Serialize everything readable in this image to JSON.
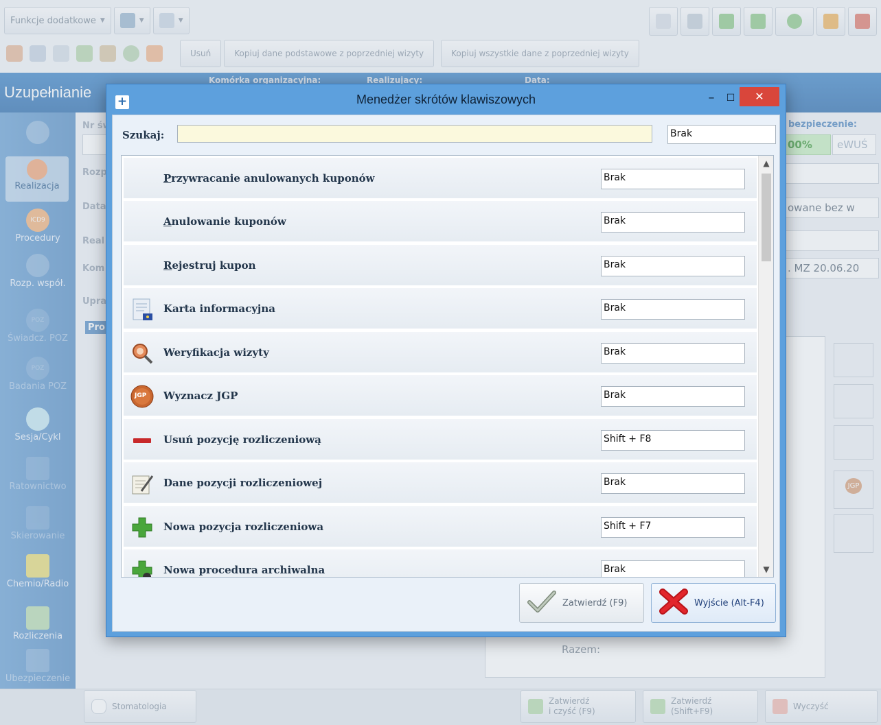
{
  "toolbar": {
    "extra_functions_label": "Funkcje dodatkowe",
    "delete_label": "Usuń",
    "copy_basic_label": "Kopiuj dane podstawowe z poprzedniej wizyty",
    "copy_all_label": "Kopiuj wszystkie dane z poprzedniej wizyty"
  },
  "header": {
    "page_title": "Uzupełnianie",
    "org_unit_label": "Komórka organizacyjna:",
    "realizer_label": "Realizujacy:",
    "date_label": "Data:"
  },
  "nav": {
    "items": [
      {
        "label": "Realizacja"
      },
      {
        "label": "Procedury"
      },
      {
        "label": "Rozp. współ."
      },
      {
        "label": "Świadcz. POZ"
      },
      {
        "label": "Badania POZ"
      },
      {
        "label": "Sesja/Cykl"
      },
      {
        "label": "Ratownictwo"
      },
      {
        "label": "Skierowanie"
      },
      {
        "label": "Chemio/Radio"
      },
      {
        "label": "Rozliczenia"
      },
      {
        "label": "Ubezpieczenie"
      }
    ],
    "icon_badges": {
      "icd9": "ICD9",
      "poz": "POZ",
      "jgp": "JGP"
    }
  },
  "form": {
    "labels": {
      "nr": "Nr św",
      "rozp": "Rozp",
      "data": "Data",
      "real": "Real",
      "kom": "Kom",
      "upr": "Upra",
      "pro": "Pro"
    },
    "insurance_label": "bezpieczenie:",
    "insurance_percent": "00%",
    "ewus_label": "eWUŚ",
    "field_status": "owane bez w",
    "field_regulation": ". MZ 20.06.20",
    "total_label": "Razem:"
  },
  "bottom": {
    "dental_label": "Stomatologia",
    "confirm_clear_label": "Zatwierdź\ni czyść (F9)",
    "confirm_shift_label": "Zatwierdź\n(Shift+F9)",
    "clear_label": "Wyczyść"
  },
  "dialog": {
    "title": "Menedżer skrótów klawiszowych",
    "search_label": "Szukaj:",
    "search_value": "",
    "search_key_value": "Brak",
    "rows": [
      {
        "label": "Przywracanie anulowanych kuponów",
        "underline": "P",
        "rest": "rzywracanie anulowanych kuponów",
        "key": "Brak",
        "icon": "none"
      },
      {
        "label": "Anulowanie kuponów",
        "underline": "A",
        "rest": "nulowanie kuponów",
        "key": "Brak",
        "icon": "none"
      },
      {
        "label": "Rejestruj kupon",
        "underline": "R",
        "rest": "ejestruj kupon",
        "key": "Brak",
        "icon": "none"
      },
      {
        "label": "Karta informacyjna",
        "key": "Brak",
        "icon": "document-eu-icon"
      },
      {
        "label": "Weryfikacja wizyty",
        "key": "Brak",
        "icon": "verify-magnifier-icon"
      },
      {
        "label": "Wyznacz JGP",
        "key": "Brak",
        "icon": "jgp-icon"
      },
      {
        "label": "Usuń pozycję rozliczeniową",
        "key": "Shift + F8",
        "icon": "minus-icon"
      },
      {
        "label": "Dane pozycji rozliczeniowej",
        "key": "Brak",
        "icon": "edit-document-icon"
      },
      {
        "label": "Nowa pozycja rozliczeniowa",
        "key": "Shift + F7",
        "icon": "plus-icon"
      },
      {
        "label": "Nowa procedura archiwalna",
        "key": "Brak",
        "icon": "plus-archive-icon"
      }
    ],
    "confirm_label": "Zatwierdź (F9)",
    "exit_label": "Wyjście (Alt-F4)"
  },
  "colors": {
    "dialog_frame": "#5da0dd",
    "close_button": "#d9463b",
    "search_bg": "#fbf9dd",
    "nav_bg": "#6ba2d6"
  }
}
